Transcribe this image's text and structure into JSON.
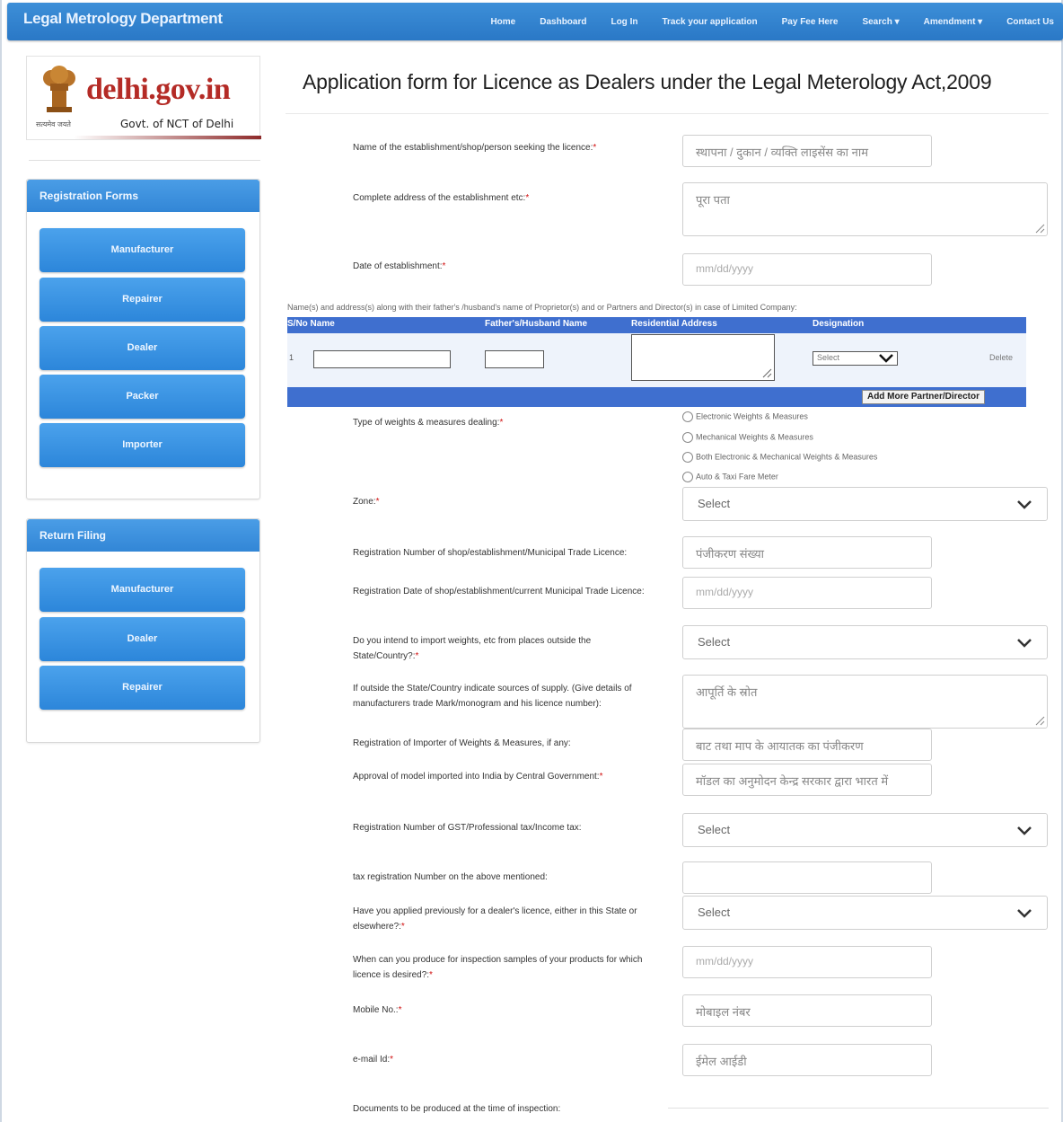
{
  "navbar": {
    "brand": "Legal Metrology Department",
    "links": [
      "Home",
      "Dashboard",
      "Log In",
      "Track your application",
      "Pay Fee Here",
      "Search ▾",
      "Amendment ▾",
      "Contact Us"
    ]
  },
  "logo": {
    "site": "delhi.gov.in",
    "tagline": "Govt. of NCT of Delhi",
    "motto": "सत्यमेव जयते"
  },
  "sidebar": {
    "registration": {
      "title": "Registration Forms",
      "buttons": [
        "Manufacturer",
        "Repairer",
        "Dealer",
        "Packer",
        "Importer"
      ]
    },
    "return_filing": {
      "title": "Return Filing",
      "buttons": [
        "Manufacturer",
        "Dealer",
        "Repairer"
      ]
    }
  },
  "form": {
    "title": "Application form for Licence as Dealers under the Legal Meterology Act,2009",
    "establishment_name": {
      "label": "Name of the establishment/shop/person seeking the licence:",
      "placeholder": "स्थापना / दुकान / व्यक्ति लाइसेंस का नाम"
    },
    "address": {
      "label": "Complete address of the establishment etc:",
      "placeholder": "पूरा पता"
    },
    "date_established": {
      "label": "Date of establishment:",
      "placeholder": "mm/dd/yyyy"
    },
    "partners": {
      "title": "Name(s) and address(s) along with their father's /husband's name of Proprietor(s) and or Partners and Director(s) in case of Limited Company:",
      "columns": [
        "S/No Name",
        "Father's/Husband Name",
        "Residential Address",
        "Designation"
      ],
      "row_number": "1",
      "designation_value": "Select",
      "delete": "Delete",
      "add_more": "Add More Partner/Director"
    },
    "weights_type": {
      "label": "Type of weights & measures dealing:",
      "options": [
        "Electronic Weights & Measures",
        "Mechanical Weights & Measures",
        "Both Electronic & Mechanical Weights & Measures",
        "Auto & Taxi Fare Meter"
      ]
    },
    "zone": {
      "label": "Zone:",
      "value": "Select"
    },
    "reg_number": {
      "label": "Registration Number of shop/establishment/Municipal Trade Licence:",
      "placeholder": "पंजीकरण संख्या"
    },
    "reg_date": {
      "label": "Registration Date of shop/establishment/current Municipal Trade Licence:",
      "placeholder": "mm/dd/yyyy"
    },
    "import_intent": {
      "label": "Do you intend to import weights, etc from places outside the State/Country?:",
      "value": "Select"
    },
    "supply_sources": {
      "label": "If outside the State/Country indicate sources of supply. (Give details of manufacturers trade Mark/monogram and his licence number):",
      "placeholder": "आपूर्ति के स्रोत"
    },
    "importer_reg": {
      "label": "Registration of Importer of Weights & Measures, if any:",
      "placeholder": "बाट तथा माप के आयातक का पंजीकरण"
    },
    "model_approval": {
      "label": "Approval of model imported into India by Central Government:",
      "placeholder": "मॉडल का अनुमोदन केन्द्र सरकार द्वारा भारत में"
    },
    "tax_reg": {
      "label": "Registration Number of GST/Professional tax/Income tax:",
      "value": "Select"
    },
    "tax_number": {
      "label": "tax registration Number on the above mentioned:",
      "placeholder": ""
    },
    "applied_before": {
      "label": "Have you applied previously for a dealer's licence, either in this State or elsewhere?:",
      "value": "Select"
    },
    "inspection_date": {
      "label": "When can you produce for inspection samples of your products for which licence is desired?:",
      "placeholder": "mm/dd/yyyy"
    },
    "mobile": {
      "label": "Mobile No.:",
      "placeholder": "मोबाइल नंबर"
    },
    "email": {
      "label": "e-mail Id:",
      "placeholder": "ईमेल आईडी"
    },
    "documents": {
      "label": "Documents to be produced at the time of inspection:"
    }
  },
  "colors": {
    "navbar": "#2a78c6",
    "sidebar_button": "#3490e0",
    "table_header": "#3f6fcf",
    "required": "#d01010",
    "logo_red": "#b42b26"
  }
}
